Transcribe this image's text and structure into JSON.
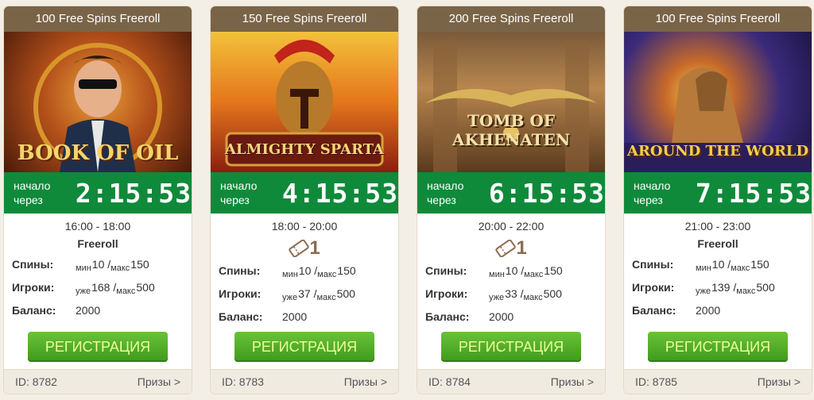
{
  "cards": [
    {
      "title": "100 Free Spins Freeroll",
      "game_name": "BOOK OF OIL",
      "timer_label": "начало через",
      "timer": "2:15:53",
      "schedule": "16:00 - 18:00",
      "type_label": "Freeroll",
      "spins_label": "Спины:",
      "spins_min_prefix": "мин",
      "spins_min": "10",
      "spins_max_prefix": "макс",
      "spins_max": "150",
      "players_label": "Игроки:",
      "players_prefix": "уже",
      "players_current": "168",
      "players_max_prefix": "макс",
      "players_max": "500",
      "balance_label": "Баланс:",
      "balance": "2000",
      "button_label": "РЕГИСТРАЦИЯ",
      "id_text": "ID: 8782",
      "prizes_label": "Призы >"
    },
    {
      "title": "150 Free Spins Freeroll",
      "game_name": "ALMIGHTY SPARTA",
      "timer_label": "начало через",
      "timer": "4:15:53",
      "schedule": "18:00 - 20:00",
      "ticket_count": "1",
      "spins_label": "Спины:",
      "spins_min_prefix": "мин",
      "spins_min": "10",
      "spins_max_prefix": "макс",
      "spins_max": "150",
      "players_label": "Игроки:",
      "players_prefix": "уже",
      "players_current": "37",
      "players_max_prefix": "макс",
      "players_max": "500",
      "balance_label": "Баланс:",
      "balance": "2000",
      "button_label": "РЕГИСТРАЦИЯ",
      "id_text": "ID: 8783",
      "prizes_label": "Призы >"
    },
    {
      "title": "200 Free Spins Freeroll",
      "game_name": "TOMB OF AKHENATEN",
      "timer_label": "начало через",
      "timer": "6:15:53",
      "schedule": "20:00 - 22:00",
      "ticket_count": "1",
      "spins_label": "Спины:",
      "spins_min_prefix": "мин",
      "spins_min": "10",
      "spins_max_prefix": "макс",
      "spins_max": "150",
      "players_label": "Игроки:",
      "players_prefix": "уже",
      "players_current": "33",
      "players_max_prefix": "макс",
      "players_max": "500",
      "balance_label": "Баланс:",
      "balance": "2000",
      "button_label": "РЕГИСТРАЦИЯ",
      "id_text": "ID: 8784",
      "prizes_label": "Призы >"
    },
    {
      "title": "100 Free Spins Freeroll",
      "game_name": "AROUND THE WORLD",
      "timer_label": "начало через",
      "timer": "7:15:53",
      "schedule": "21:00 - 23:00",
      "type_label": "Freeroll",
      "spins_label": "Спины:",
      "spins_min_prefix": "мин",
      "spins_min": "10",
      "spins_max_prefix": "макс",
      "spins_max": "150",
      "players_label": "Игроки:",
      "players_prefix": "уже",
      "players_current": "139",
      "players_max_prefix": "макс",
      "players_max": "500",
      "balance_label": "Баланс:",
      "balance": "2000",
      "button_label": "РЕГИСТРАЦИЯ",
      "id_text": "ID: 8785",
      "prizes_label": "Призы >"
    }
  ],
  "colors": {
    "header": "#7a6448",
    "timer_bg": "#0f8a3a",
    "button": "#4fa826",
    "ticket": "#8b6d52"
  }
}
